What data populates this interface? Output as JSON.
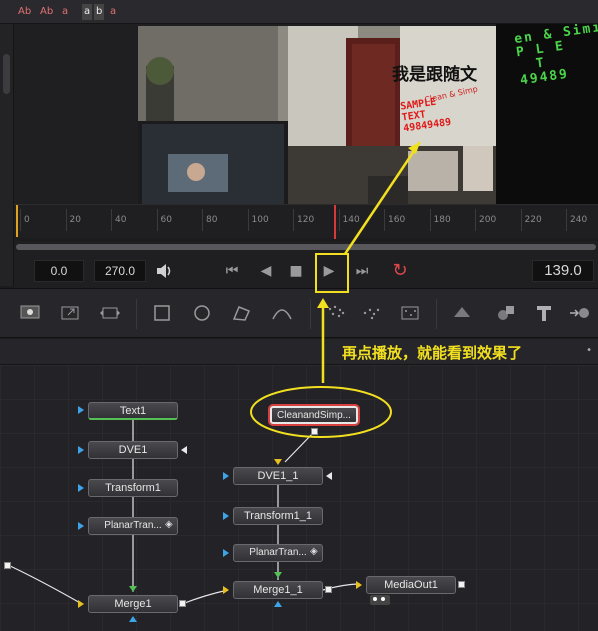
{
  "top_strip": {
    "icons": [
      {
        "name": "text-style-icon",
        "label": "Ab"
      },
      {
        "name": "text-style-icon",
        "label": "Ab"
      },
      {
        "name": "text-style-icon",
        "label": "a"
      },
      {
        "name": "text-style-icon",
        "label": "a"
      },
      {
        "name": "text-style-icon",
        "label": "b"
      },
      {
        "name": "text-style-icon",
        "label": "a"
      }
    ]
  },
  "viewer": {
    "overlay_title": "我是跟随文",
    "overlay_small": "Clean & Simp",
    "sample_lines": [
      "SAMPLE",
      "TEXT",
      "49849489"
    ],
    "green_text": [
      "en & Simi",
      "P L E",
      "T",
      "49489"
    ]
  },
  "ruler": {
    "ticks": [
      "0",
      "20",
      "40",
      "60",
      "80",
      "100",
      "120",
      "140",
      "160",
      "180",
      "200",
      "220",
      "240"
    ],
    "playhead_frame": 139
  },
  "transport": {
    "start_time": "0.0",
    "end_time": "270.0",
    "current_time": "139.0",
    "volume_icon": "speaker-icon",
    "buttons": [
      {
        "name": "go-to-start-button",
        "glyph": "⏮"
      },
      {
        "name": "play-reverse-button",
        "glyph": "◀"
      },
      {
        "name": "stop-button",
        "glyph": "■"
      },
      {
        "name": "play-forward-button",
        "glyph": "▶"
      },
      {
        "name": "go-to-end-button",
        "glyph": "⏭"
      },
      {
        "name": "loop-button",
        "glyph": "↻"
      }
    ]
  },
  "annotation": {
    "label": "再点播放，就能看到效果了",
    "color": "#f2e020"
  },
  "nodes": {
    "text1": "Text1",
    "dve1": "DVE1",
    "transform1": "Transform1",
    "planar1": "PlanarTran...",
    "merge1": "Merge1",
    "clean": "CleanandSimp...",
    "dve1_1": "DVE1_1",
    "transform1_1": "Transform1_1",
    "planar1_1": "PlanarTran...",
    "merge1_1": "Merge1_1",
    "mediaout": "MediaOut1"
  },
  "colors": {
    "accent_red": "#d83a3a",
    "annotation_yellow": "#f2e020",
    "input_blue": "#3ea4e8",
    "input_yellow": "#e8c020",
    "green_text": "#4bd54b"
  }
}
